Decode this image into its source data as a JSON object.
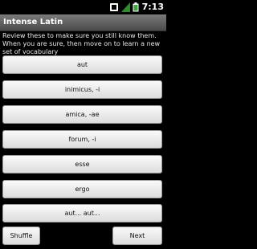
{
  "status_bar": {
    "time": "7:13",
    "icons": [
      "notification-icon",
      "signal-icon",
      "battery-icon"
    ]
  },
  "title_bar": {
    "title": "Intense Latin"
  },
  "instructions": "Review these to make sure you still know them. When you are sure, then move on to learn a new set of vocabulary",
  "words": [
    "aut",
    "inimicus, -i",
    "amica, -ae",
    "forum, -i",
    "esse",
    "ergo",
    "aut... aut..."
  ],
  "buttons": {
    "shuffle": "Shuffle",
    "next": "Next"
  }
}
